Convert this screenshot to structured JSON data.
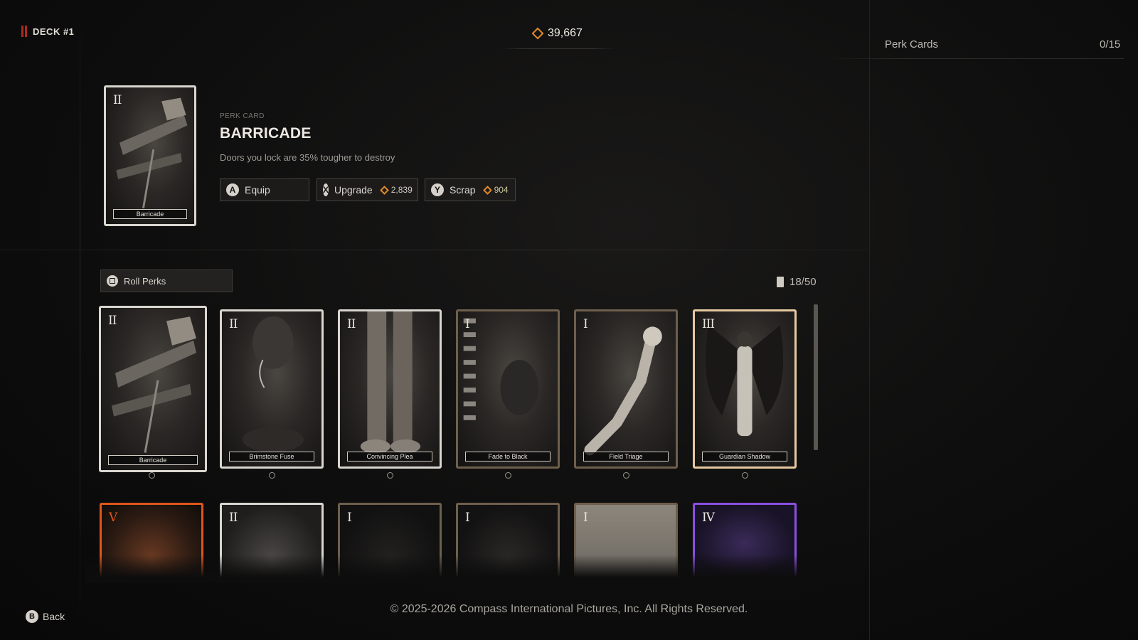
{
  "header": {
    "deck_label": "DECK #1",
    "currency": "39,667"
  },
  "side_panel": {
    "title": "Perk Cards",
    "count": "0/15"
  },
  "selected_card": {
    "tier": "II",
    "card_name": "Barricade",
    "kind": "PERK CARD",
    "title": "BARRICADE",
    "description": "Doors you lock are 35% tougher to destroy"
  },
  "actions": {
    "equip": {
      "key": "A",
      "label": "Equip"
    },
    "upgrade": {
      "key": "X",
      "label": "Upgrade",
      "cost": "2,839"
    },
    "scrap": {
      "key": "Y",
      "label": "Scrap",
      "cost": "904"
    }
  },
  "roll": {
    "label": "Roll Perks"
  },
  "stock": "18/50",
  "cards_row1": [
    {
      "tier": "II",
      "name": "Barricade",
      "border": "#d9d6d0"
    },
    {
      "tier": "II",
      "name": "Brimstone Fuse",
      "border": "#d9d6d0"
    },
    {
      "tier": "II",
      "name": "Convincing Plea",
      "border": "#d9d6d0"
    },
    {
      "tier": "I",
      "name": "Fade to Black",
      "border": "#6e5f4d"
    },
    {
      "tier": "I",
      "name": "Field Triage",
      "border": "#6e5f4d"
    },
    {
      "tier": "III",
      "name": "Guardian Shadow",
      "border": "#e6c9a0"
    }
  ],
  "cards_row2": [
    {
      "tier": "V",
      "border": "#e0561c"
    },
    {
      "tier": "II",
      "border": "#d9d6d0"
    },
    {
      "tier": "I",
      "border": "#6e5f4d"
    },
    {
      "tier": "I",
      "border": "#6e5f4d"
    },
    {
      "tier": "I",
      "border": "#6e5f4d"
    },
    {
      "tier": "IV",
      "border": "#8a4fe0"
    }
  ],
  "footer": {
    "back_key": "B",
    "back_label": "Back",
    "copyright": "© 2025-2026 Compass International Pictures, Inc. All Rights Reserved."
  }
}
